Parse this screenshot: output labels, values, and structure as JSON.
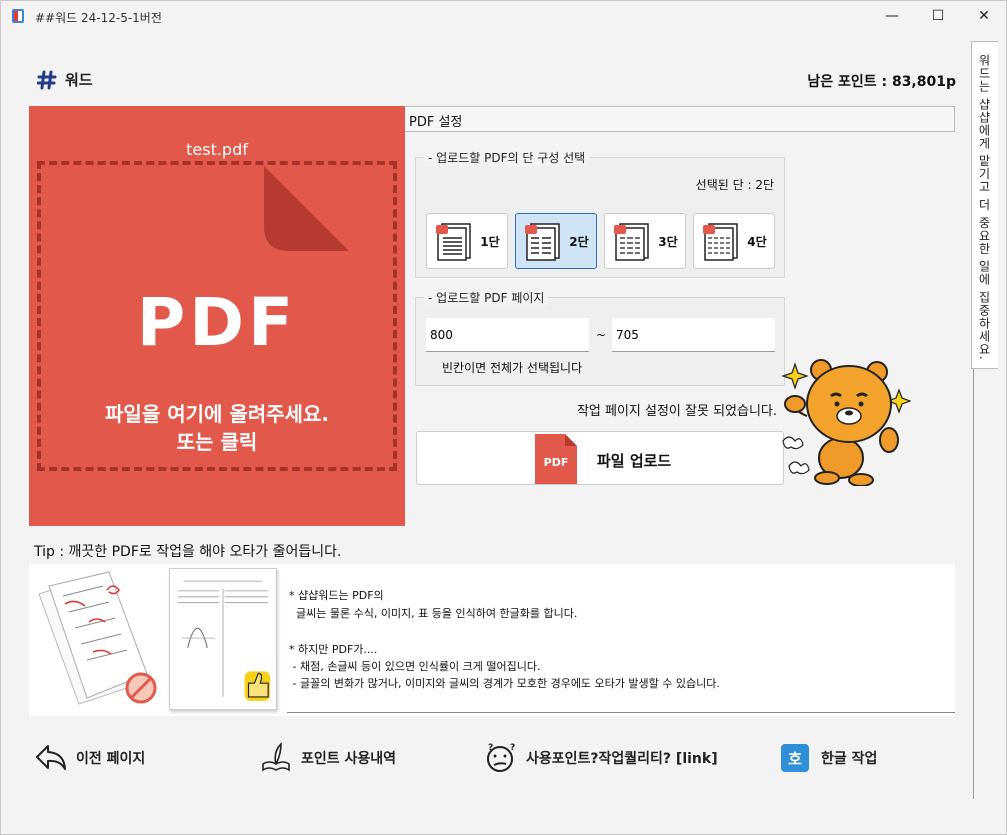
{
  "window": {
    "title": "##워드 24-12-5-1버전",
    "minimize": "—",
    "maximize": "☐",
    "close": "✕"
  },
  "header": {
    "brand_icon": "hashtag-icon",
    "brand": "워드",
    "points_label": "남은 포인트 : 83,801p"
  },
  "side_tab": {
    "text": "워드는 샵샵에게 맡기고 더 중요한 일에 집중하세요."
  },
  "dropzone": {
    "filename": "test.pdf",
    "pdf_label": "PDF",
    "message_line1": "파일을 여기에 올려주세요.",
    "message_line2": "또는 클릭",
    "bg_color": "#e2594b"
  },
  "settings": {
    "header": "PDF 설정",
    "columns_group_title": "업로드할 PDF의 단 구성 선택",
    "selected_columns": "선택된 단 : 2단",
    "column_options": [
      "1단",
      "2단",
      "3단",
      "4단"
    ],
    "selected_index": 1,
    "pages_group_title": "업로드할 PDF 페이지",
    "page_from": "800",
    "page_to": "705",
    "range_sep": "~",
    "hint": "빈칸이면 전체가 선택됩니다",
    "warning": "작업 페이지 설정이 잘못 되었습니다.",
    "upload_button": "파일 업로드",
    "upload_icon_text": "PDF"
  },
  "tip": {
    "title": "Tip : 깨끗한 PDF로 작업을 해야 오타가 줄어듭니다.",
    "lines": [
      "* 샵샵워드는 PDF의",
      "  글씨는 물론 수식, 이미지, 표 등을 인식하여 한글화를 합니다.",
      "",
      "* 하지만 PDF가....",
      " - 채점, 손글씨 등이 있으면 인식률이 크게 떨어집니다.",
      " - 글꼴의 변화가 많거나, 이미지와 글씨의 경계가 모호한 경우에도 오타가 발생할 수 있습니다."
    ]
  },
  "nav": {
    "prev": "이전 페이지",
    "history": "포인트 사용내역",
    "quality": "사용포인트?작업퀄리티? [link]",
    "hangul": "한글 작업",
    "hangul_icon_text": "호"
  }
}
